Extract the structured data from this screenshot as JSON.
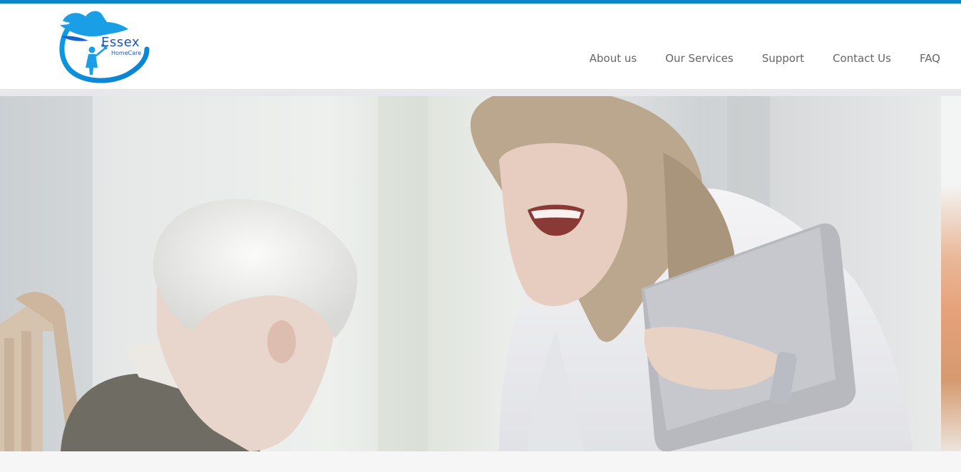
{
  "brand": {
    "name": "Essex",
    "tagline": "HomeCare",
    "primary_color": "#0a86c8",
    "logo_blue": "#1b56b7",
    "logo_icon": "dove-and-child-logo-icon"
  },
  "nav": {
    "items": [
      {
        "label": "About us"
      },
      {
        "label": "Our Services"
      },
      {
        "label": "Support"
      },
      {
        "label": "Contact Us"
      },
      {
        "label": "FAQ"
      }
    ]
  },
  "hero": {
    "image": "caregiver-laughing-with-elderly-man-photo"
  }
}
